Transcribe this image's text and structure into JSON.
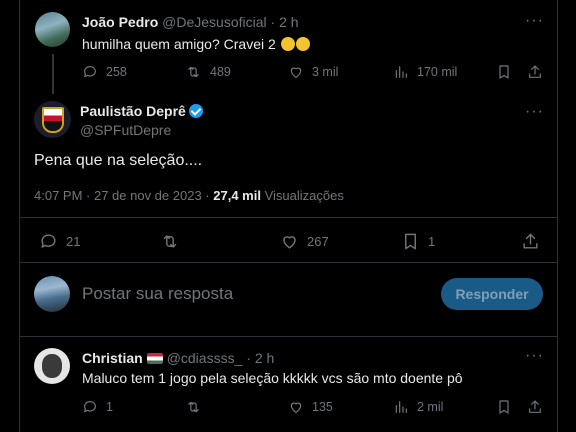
{
  "tweet1": {
    "name": "João Pedro",
    "handle": "@DeJesusoficial",
    "time": "· 2 h",
    "text": "humilha quem amigo? Cravei 2",
    "replies": "258",
    "retweets": "489",
    "likes": "3 mil",
    "views": "170 mil"
  },
  "main": {
    "name": "Paulistão Deprê",
    "handle": "@SPFutDepre",
    "text": "Pena que na seleção....",
    "timestamp": "4:07 PM · 27 de nov de 2023 ·",
    "views_count": "27,4 mil",
    "views_label": "Visualizações",
    "replies": "21",
    "likes": "267",
    "bookmarks": "1"
  },
  "composer": {
    "placeholder": "Postar sua resposta",
    "button": "Responder"
  },
  "tweet2": {
    "name": "Christian",
    "handle": "@cdiassss_",
    "time": "· 2 h",
    "text": "Maluco tem 1 jogo pela seleção kkkkk vcs são mto doente pô",
    "replies": "1",
    "likes": "135",
    "views": "2 mil"
  },
  "colors": {
    "accent": "#1d9bf0",
    "button_bg": "#1a5a86",
    "muted": "#71767b",
    "border": "#2f3336"
  },
  "icons": [
    "reply-icon",
    "retweet-icon",
    "like-icon",
    "views-icon",
    "bookmark-icon",
    "share-icon",
    "more-icon",
    "verified-icon",
    "flag-icon",
    "laughing-emoji-icon"
  ]
}
